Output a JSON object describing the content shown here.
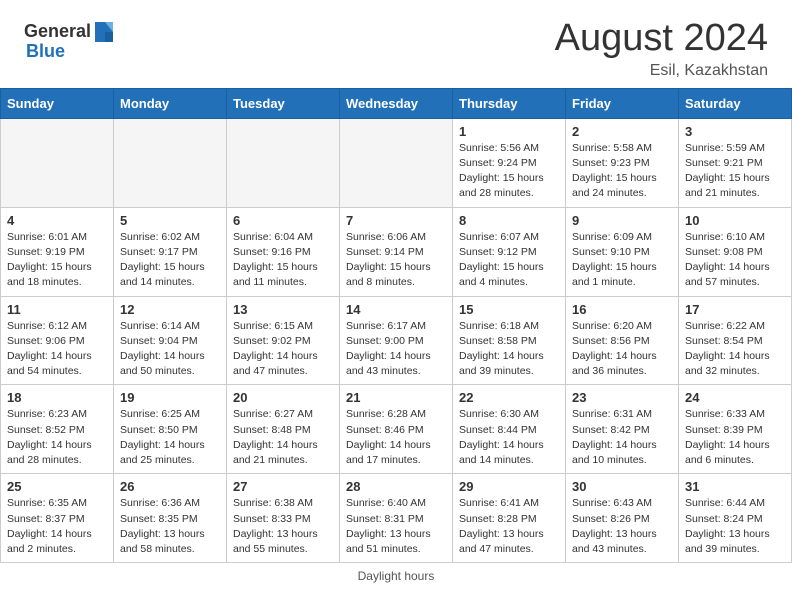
{
  "header": {
    "logo_general": "General",
    "logo_blue": "Blue",
    "month_year": "August 2024",
    "location": "Esil, Kazakhstan"
  },
  "days_of_week": [
    "Sunday",
    "Monday",
    "Tuesday",
    "Wednesday",
    "Thursday",
    "Friday",
    "Saturday"
  ],
  "footer": "Daylight hours",
  "weeks": [
    [
      {
        "day": null,
        "info": null
      },
      {
        "day": null,
        "info": null
      },
      {
        "day": null,
        "info": null
      },
      {
        "day": null,
        "info": null
      },
      {
        "day": "1",
        "info": "Sunrise: 5:56 AM\nSunset: 9:24 PM\nDaylight: 15 hours\nand 28 minutes."
      },
      {
        "day": "2",
        "info": "Sunrise: 5:58 AM\nSunset: 9:23 PM\nDaylight: 15 hours\nand 24 minutes."
      },
      {
        "day": "3",
        "info": "Sunrise: 5:59 AM\nSunset: 9:21 PM\nDaylight: 15 hours\nand 21 minutes."
      }
    ],
    [
      {
        "day": "4",
        "info": "Sunrise: 6:01 AM\nSunset: 9:19 PM\nDaylight: 15 hours\nand 18 minutes."
      },
      {
        "day": "5",
        "info": "Sunrise: 6:02 AM\nSunset: 9:17 PM\nDaylight: 15 hours\nand 14 minutes."
      },
      {
        "day": "6",
        "info": "Sunrise: 6:04 AM\nSunset: 9:16 PM\nDaylight: 15 hours\nand 11 minutes."
      },
      {
        "day": "7",
        "info": "Sunrise: 6:06 AM\nSunset: 9:14 PM\nDaylight: 15 hours\nand 8 minutes."
      },
      {
        "day": "8",
        "info": "Sunrise: 6:07 AM\nSunset: 9:12 PM\nDaylight: 15 hours\nand 4 minutes."
      },
      {
        "day": "9",
        "info": "Sunrise: 6:09 AM\nSunset: 9:10 PM\nDaylight: 15 hours\nand 1 minute."
      },
      {
        "day": "10",
        "info": "Sunrise: 6:10 AM\nSunset: 9:08 PM\nDaylight: 14 hours\nand 57 minutes."
      }
    ],
    [
      {
        "day": "11",
        "info": "Sunrise: 6:12 AM\nSunset: 9:06 PM\nDaylight: 14 hours\nand 54 minutes."
      },
      {
        "day": "12",
        "info": "Sunrise: 6:14 AM\nSunset: 9:04 PM\nDaylight: 14 hours\nand 50 minutes."
      },
      {
        "day": "13",
        "info": "Sunrise: 6:15 AM\nSunset: 9:02 PM\nDaylight: 14 hours\nand 47 minutes."
      },
      {
        "day": "14",
        "info": "Sunrise: 6:17 AM\nSunset: 9:00 PM\nDaylight: 14 hours\nand 43 minutes."
      },
      {
        "day": "15",
        "info": "Sunrise: 6:18 AM\nSunset: 8:58 PM\nDaylight: 14 hours\nand 39 minutes."
      },
      {
        "day": "16",
        "info": "Sunrise: 6:20 AM\nSunset: 8:56 PM\nDaylight: 14 hours\nand 36 minutes."
      },
      {
        "day": "17",
        "info": "Sunrise: 6:22 AM\nSunset: 8:54 PM\nDaylight: 14 hours\nand 32 minutes."
      }
    ],
    [
      {
        "day": "18",
        "info": "Sunrise: 6:23 AM\nSunset: 8:52 PM\nDaylight: 14 hours\nand 28 minutes."
      },
      {
        "day": "19",
        "info": "Sunrise: 6:25 AM\nSunset: 8:50 PM\nDaylight: 14 hours\nand 25 minutes."
      },
      {
        "day": "20",
        "info": "Sunrise: 6:27 AM\nSunset: 8:48 PM\nDaylight: 14 hours\nand 21 minutes."
      },
      {
        "day": "21",
        "info": "Sunrise: 6:28 AM\nSunset: 8:46 PM\nDaylight: 14 hours\nand 17 minutes."
      },
      {
        "day": "22",
        "info": "Sunrise: 6:30 AM\nSunset: 8:44 PM\nDaylight: 14 hours\nand 14 minutes."
      },
      {
        "day": "23",
        "info": "Sunrise: 6:31 AM\nSunset: 8:42 PM\nDaylight: 14 hours\nand 10 minutes."
      },
      {
        "day": "24",
        "info": "Sunrise: 6:33 AM\nSunset: 8:39 PM\nDaylight: 14 hours\nand 6 minutes."
      }
    ],
    [
      {
        "day": "25",
        "info": "Sunrise: 6:35 AM\nSunset: 8:37 PM\nDaylight: 14 hours\nand 2 minutes."
      },
      {
        "day": "26",
        "info": "Sunrise: 6:36 AM\nSunset: 8:35 PM\nDaylight: 13 hours\nand 58 minutes."
      },
      {
        "day": "27",
        "info": "Sunrise: 6:38 AM\nSunset: 8:33 PM\nDaylight: 13 hours\nand 55 minutes."
      },
      {
        "day": "28",
        "info": "Sunrise: 6:40 AM\nSunset: 8:31 PM\nDaylight: 13 hours\nand 51 minutes."
      },
      {
        "day": "29",
        "info": "Sunrise: 6:41 AM\nSunset: 8:28 PM\nDaylight: 13 hours\nand 47 minutes."
      },
      {
        "day": "30",
        "info": "Sunrise: 6:43 AM\nSunset: 8:26 PM\nDaylight: 13 hours\nand 43 minutes."
      },
      {
        "day": "31",
        "info": "Sunrise: 6:44 AM\nSunset: 8:24 PM\nDaylight: 13 hours\nand 39 minutes."
      }
    ]
  ]
}
